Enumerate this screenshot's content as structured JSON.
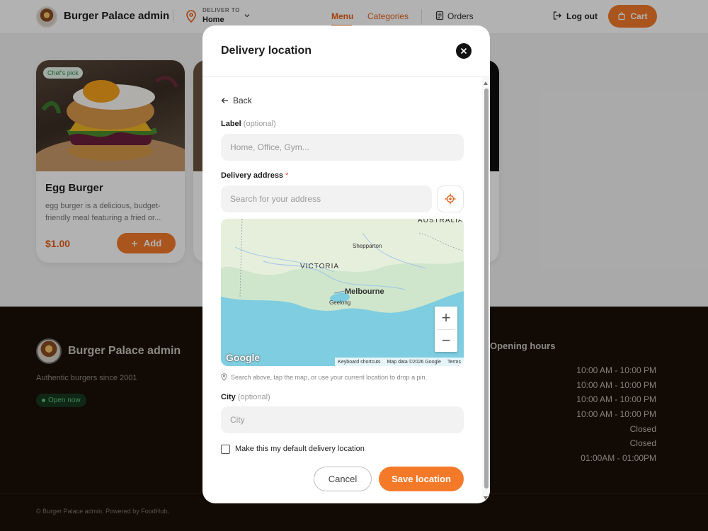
{
  "header": {
    "brand": "Burger Palace admin",
    "deliver_to_label": "DELIVER TO",
    "deliver_to_value": "Home",
    "nav": {
      "menu": "Menu",
      "categories": "Categories",
      "orders": "Orders"
    },
    "logout": "Log out",
    "cart": "Cart"
  },
  "cards": [
    {
      "badge": "Chef's pick",
      "title": "Egg Burger",
      "description": "egg burger is a delicious, budget-friendly meal featuring a fried or...",
      "price": "$1.00",
      "add_label": "Add"
    }
  ],
  "footer": {
    "brand": "Burger Palace admin",
    "tagline": "Authentic burgers since 2001",
    "status": "Open now",
    "hours_title": "Opening hours",
    "hours": [
      "10:00 AM - 10:00 PM",
      "10:00 AM - 10:00 PM",
      "10:00 AM - 10:00 PM",
      "10:00 AM - 10:00 PM",
      "Closed",
      "Closed",
      "01:00AM - 01:00PM"
    ],
    "copyright": "© Burger Palace admin. Powered by FoodHub."
  },
  "modal": {
    "title": "Delivery location",
    "back": "Back",
    "label_field": {
      "label": "Label",
      "optional": "(optional)",
      "placeholder": "Home, Office, Gym..."
    },
    "address_field": {
      "label": "Delivery address",
      "required": "*",
      "placeholder": "Search for your address"
    },
    "map": {
      "labels": {
        "act": "AUSTRALIAN CAPITAL TERRITORY",
        "shepparton": "Shepparton",
        "victoria": "VICTORIA",
        "melbourne": "Melbourne",
        "geelong": "Geelong"
      },
      "zoom_in": "+",
      "zoom_out": "−",
      "google": "Google",
      "footer": {
        "shortcuts": "Keyboard shortcuts",
        "data": "Map data ©2026 Google",
        "terms": "Terms"
      }
    },
    "map_hint": "Search above, tap the map, or use your current location to drop a pin.",
    "city_field": {
      "label": "City",
      "optional": "(optional)",
      "placeholder": "City"
    },
    "default_checkbox": "Make this my default delivery location",
    "cancel": "Cancel",
    "save": "Save location"
  },
  "colors": {
    "accent": "#f47a2a",
    "accent_text": "#e8601c",
    "footer_bg": "#1a1008",
    "open_green": "#5cc27a"
  }
}
